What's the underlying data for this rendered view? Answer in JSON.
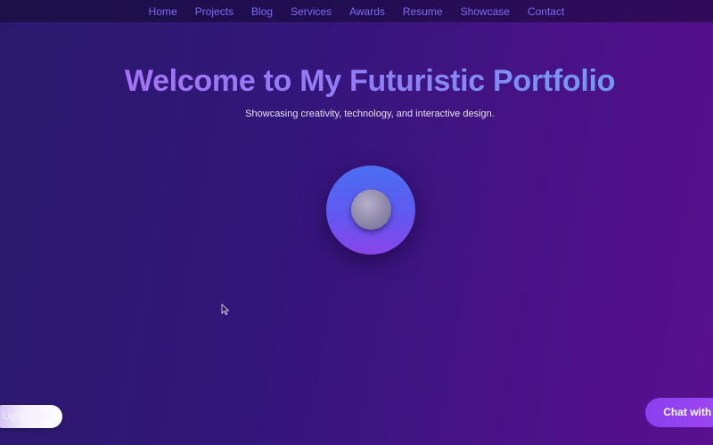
{
  "nav": {
    "items": [
      {
        "label": "Home"
      },
      {
        "label": "Projects"
      },
      {
        "label": "Blog"
      },
      {
        "label": "Services"
      },
      {
        "label": "Awards"
      },
      {
        "label": "Resume"
      },
      {
        "label": "Showcase"
      },
      {
        "label": "Contact"
      }
    ]
  },
  "hero": {
    "title": "Welcome to My Futuristic Portfolio",
    "subtitle": "Showcasing creativity, technology, and interactive design."
  },
  "buttons": {
    "light_mode": "Light Mode",
    "chat": "Chat with A"
  },
  "colors": {
    "nav_link": "#7b6cf0",
    "accent_purple": "#8a3ff0",
    "orb_blue": "#4a6ff2"
  }
}
